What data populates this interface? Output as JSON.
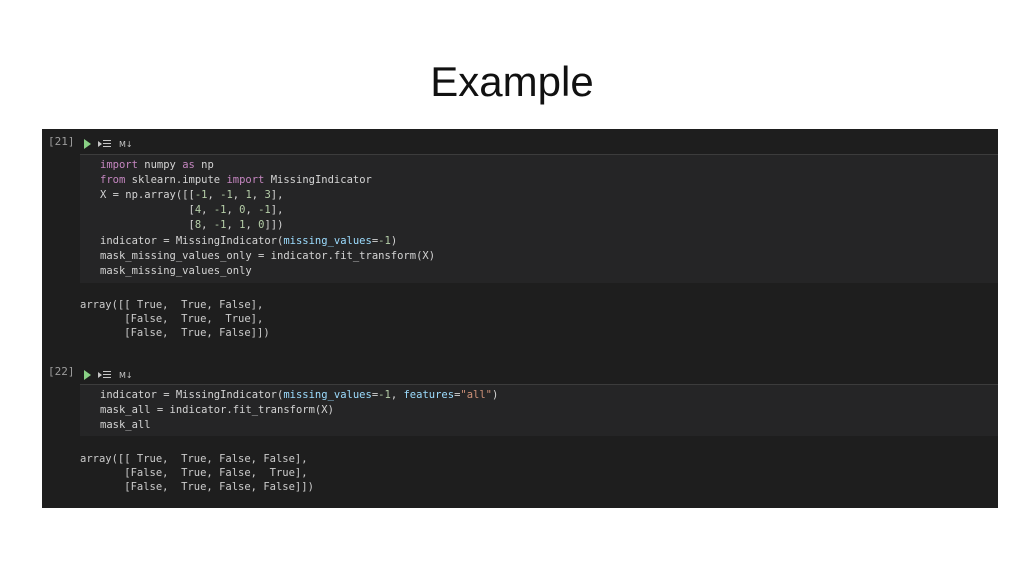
{
  "slide": {
    "title": "Example"
  },
  "cells": [
    {
      "prompt": "[21]",
      "md_label": "M↓",
      "code": [
        [
          {
            "t": "import",
            "c": "kw"
          },
          {
            "t": " numpy ",
            "c": ""
          },
          {
            "t": "as",
            "c": "kw"
          },
          {
            "t": " np",
            "c": ""
          }
        ],
        [
          {
            "t": "from",
            "c": "kw"
          },
          {
            "t": " sklearn.impute ",
            "c": ""
          },
          {
            "t": "import",
            "c": "kw"
          },
          {
            "t": " MissingIndicator",
            "c": ""
          }
        ],
        [
          {
            "t": "X = np.array([[",
            "c": ""
          },
          {
            "t": "-1",
            "c": "num"
          },
          {
            "t": ", ",
            "c": ""
          },
          {
            "t": "-1",
            "c": "num"
          },
          {
            "t": ", ",
            "c": ""
          },
          {
            "t": "1",
            "c": "num"
          },
          {
            "t": ", ",
            "c": ""
          },
          {
            "t": "3",
            "c": "num"
          },
          {
            "t": "],",
            "c": ""
          }
        ],
        [
          {
            "t": "              [",
            "c": ""
          },
          {
            "t": "4",
            "c": "num"
          },
          {
            "t": ", ",
            "c": ""
          },
          {
            "t": "-1",
            "c": "num"
          },
          {
            "t": ", ",
            "c": ""
          },
          {
            "t": "0",
            "c": "num"
          },
          {
            "t": ", ",
            "c": ""
          },
          {
            "t": "-1",
            "c": "num"
          },
          {
            "t": "],",
            "c": ""
          }
        ],
        [
          {
            "t": "              [",
            "c": ""
          },
          {
            "t": "8",
            "c": "num"
          },
          {
            "t": ", ",
            "c": ""
          },
          {
            "t": "-1",
            "c": "num"
          },
          {
            "t": ", ",
            "c": ""
          },
          {
            "t": "1",
            "c": "num"
          },
          {
            "t": ", ",
            "c": ""
          },
          {
            "t": "0",
            "c": "num"
          },
          {
            "t": "]])",
            "c": ""
          }
        ],
        [
          {
            "t": "indicator = MissingIndicator(",
            "c": ""
          },
          {
            "t": "missing_values",
            "c": "param"
          },
          {
            "t": "=",
            "c": ""
          },
          {
            "t": "-1",
            "c": "num"
          },
          {
            "t": ")",
            "c": ""
          }
        ],
        [
          {
            "t": "mask_missing_values_only = indicator.fit_transform(X)",
            "c": ""
          }
        ],
        [
          {
            "t": "mask_missing_values_only",
            "c": ""
          }
        ]
      ],
      "output": [
        "array([[ True,  True, False],",
        "       [False,  True,  True],",
        "       [False,  True, False]])"
      ]
    },
    {
      "prompt": "[22]",
      "md_label": "M↓",
      "code": [
        [
          {
            "t": "indicator = MissingIndicator(",
            "c": ""
          },
          {
            "t": "missing_values",
            "c": "param"
          },
          {
            "t": "=",
            "c": ""
          },
          {
            "t": "-1",
            "c": "num"
          },
          {
            "t": ", ",
            "c": ""
          },
          {
            "t": "features",
            "c": "param"
          },
          {
            "t": "=",
            "c": ""
          },
          {
            "t": "\"all\"",
            "c": "str"
          },
          {
            "t": ")",
            "c": ""
          }
        ],
        [
          {
            "t": "mask_all = indicator.fit_transform(X)",
            "c": ""
          }
        ],
        [
          {
            "t": "mask_all",
            "c": ""
          }
        ]
      ],
      "output": [
        "array([[ True,  True, False, False],",
        "       [False,  True, False,  True],",
        "       [False,  True, False, False]])"
      ]
    }
  ]
}
